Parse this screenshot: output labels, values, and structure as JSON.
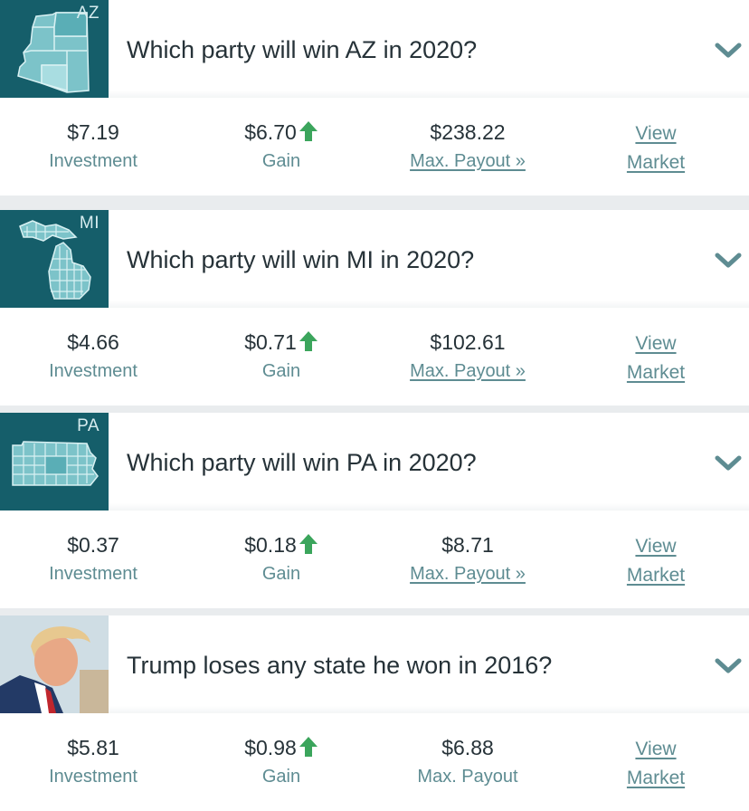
{
  "markets": [
    {
      "code": "AZ",
      "title": "Which party will win AZ in 2020?",
      "investment": "$7.19",
      "investment_label": "Investment",
      "gain": "$6.70",
      "gain_label": "Gain",
      "payout": "$238.22",
      "payout_label": "Max. Payout »",
      "view_label_1": "View",
      "view_label_2": "Market"
    },
    {
      "code": "MI",
      "title": "Which party will win MI in 2020?",
      "investment": "$4.66",
      "investment_label": "Investment",
      "gain": "$0.71",
      "gain_label": "Gain",
      "payout": "$102.61",
      "payout_label": "Max. Payout »",
      "view_label_1": "View",
      "view_label_2": "Market"
    },
    {
      "code": "PA",
      "title": "Which party will win PA in 2020?",
      "investment": "$0.37",
      "investment_label": "Investment",
      "gain": "$0.18",
      "gain_label": "Gain",
      "payout": "$8.71",
      "payout_label": "Max. Payout »",
      "view_label_1": "View",
      "view_label_2": "Market"
    },
    {
      "code": "",
      "title": "Trump loses any state he won in 2016?",
      "investment": "$5.81",
      "investment_label": "Investment",
      "gain": "$0.98",
      "gain_label": "Gain",
      "payout": "$6.88",
      "payout_label": "Max. Payout",
      "view_label_1": "View",
      "view_label_2": "Market"
    }
  ],
  "colors": {
    "teal_dark": "#155e6a",
    "teal_text": "#5e8c92",
    "gain_arrow": "#3ba55c",
    "text_dark": "#263238"
  },
  "icons": {
    "gain": "arrow-up-icon",
    "expand": "chevron-down-icon"
  }
}
